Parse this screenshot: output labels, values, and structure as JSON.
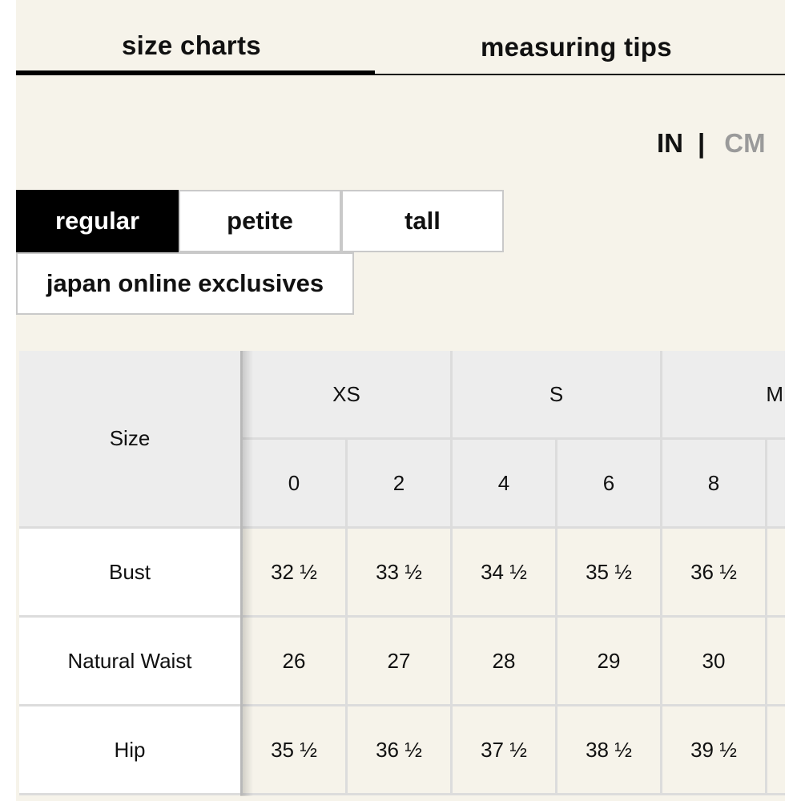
{
  "tabs": {
    "size_charts": "size charts",
    "measuring_tips": "measuring tips"
  },
  "units": {
    "in": "IN",
    "separator": "|",
    "cm": "CM"
  },
  "fits": {
    "regular": "regular",
    "petite": "petite",
    "tall": "tall",
    "japan": "japan online exclusives"
  },
  "table": {
    "size_label": "Size",
    "groups": [
      "XS",
      "S",
      "M"
    ],
    "sizes": [
      "0",
      "2",
      "4",
      "6",
      "8"
    ],
    "rows": [
      {
        "label": "Bust",
        "values": [
          "32 ½",
          "33 ½",
          "34 ½",
          "35 ½",
          "36 ½"
        ]
      },
      {
        "label": "Natural Waist",
        "values": [
          "26",
          "27",
          "28",
          "29",
          "30"
        ]
      },
      {
        "label": "Hip",
        "values": [
          "35 ½",
          "36 ½",
          "37 ½",
          "38 ½",
          "39 ½"
        ]
      }
    ]
  },
  "colors": {
    "background": "#f6f3ea",
    "header": "#ededed",
    "active_button": "#000000",
    "inactive_unit": "#9a9a9a"
  }
}
